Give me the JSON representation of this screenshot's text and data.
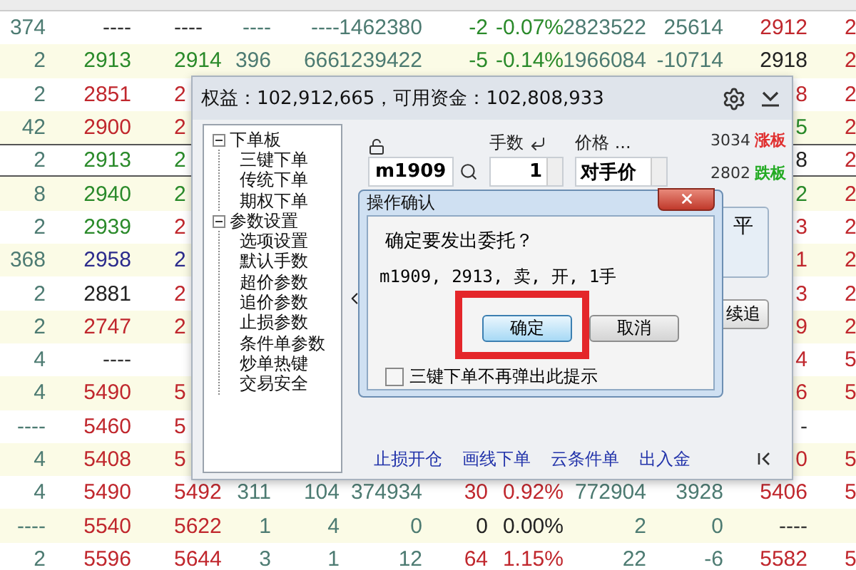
{
  "quote_table": {
    "rows": [
      {
        "selected": false,
        "cells": [
          {
            "text": "374",
            "color": "#4d7b72"
          },
          {
            "text": "----",
            "color": "#333333"
          },
          {
            "text": "----",
            "color": "#333333"
          },
          {
            "text": "----",
            "color": "#4d7b72"
          },
          {
            "text": "----",
            "color": "#4d7b72"
          },
          {
            "text": "1462380",
            "color": "#4d7b72"
          },
          {
            "text": "-2",
            "color": "#2a8a2a"
          },
          {
            "text": "-0.07%",
            "color": "#2a8a2a"
          },
          {
            "text": "2823522",
            "color": "#4d7b72"
          },
          {
            "text": "25614",
            "color": "#4d7b72"
          },
          {
            "text": "2912",
            "color": "#c0272d"
          },
          {
            "text": "2",
            "color": "#c0272d"
          }
        ]
      },
      {
        "selected": false,
        "cells": [
          {
            "text": "2",
            "color": "#4d7b72"
          },
          {
            "text": "2913",
            "color": "#2a8a2a"
          },
          {
            "text": "2914",
            "color": "#2a8a2a"
          },
          {
            "text": "396",
            "color": "#4d7b72"
          },
          {
            "text": "666",
            "color": "#4d7b72"
          },
          {
            "text": "1239422",
            "color": "#4d7b72"
          },
          {
            "text": "-5",
            "color": "#2a8a2a"
          },
          {
            "text": "-0.14%",
            "color": "#2a8a2a"
          },
          {
            "text": "1966084",
            "color": "#4d7b72"
          },
          {
            "text": "-10714",
            "color": "#4d7b72"
          },
          {
            "text": "2918",
            "color": "#222222"
          },
          {
            "text": "2",
            "color": "#c0272d"
          }
        ]
      },
      {
        "selected": false,
        "cells": [
          {
            "text": "2",
            "color": "#4d7b72"
          },
          {
            "text": "2851",
            "color": "#c0272d"
          },
          {
            "text": "2",
            "color": "#c0272d"
          },
          "",
          "",
          "",
          "",
          "",
          "",
          "",
          {
            "text": "8",
            "color": "#c0272d"
          },
          {
            "text": "2",
            "color": "#c0272d"
          }
        ]
      },
      {
        "selected": false,
        "cells": [
          {
            "text": "42",
            "color": "#4d7b72"
          },
          {
            "text": "2900",
            "color": "#c0272d"
          },
          {
            "text": "2",
            "color": "#c0272d"
          },
          "",
          "",
          "",
          "",
          "",
          "",
          "",
          {
            "text": "5",
            "color": "#2a8a2a"
          },
          {
            "text": "2",
            "color": "#c0272d"
          }
        ]
      },
      {
        "selected": true,
        "cells": [
          {
            "text": "2",
            "color": "#4d7b72"
          },
          {
            "text": "2913",
            "color": "#2a8a2a"
          },
          {
            "text": "2",
            "color": "#2a8a2a"
          },
          "",
          "",
          "",
          "",
          "",
          "",
          "",
          {
            "text": "8",
            "color": "#222222"
          },
          {
            "text": "2",
            "color": "#c0272d"
          }
        ]
      },
      {
        "selected": false,
        "cells": [
          {
            "text": "8",
            "color": "#4d7b72"
          },
          {
            "text": "2940",
            "color": "#2a8a2a"
          },
          {
            "text": "2",
            "color": "#2a8a2a"
          },
          "",
          "",
          "",
          "",
          "",
          "",
          "",
          {
            "text": "2",
            "color": "#2a8a2a"
          },
          {
            "text": "2",
            "color": "#c0272d"
          }
        ]
      },
      {
        "selected": false,
        "cells": [
          {
            "text": "2",
            "color": "#4d7b72"
          },
          {
            "text": "2939",
            "color": "#2a8a2a"
          },
          {
            "text": "2",
            "color": "#c0272d"
          },
          "",
          "",
          "",
          "",
          "",
          "",
          "",
          {
            "text": "3",
            "color": "#c0272d"
          },
          {
            "text": "2",
            "color": "#c0272d"
          }
        ]
      },
      {
        "selected": false,
        "cells": [
          {
            "text": "368",
            "color": "#4d7b72"
          },
          {
            "text": "2958",
            "color": "#2b2b8c"
          },
          {
            "text": "2",
            "color": "#2b2b8c"
          },
          "",
          "",
          "",
          "",
          "",
          "",
          "",
          {
            "text": "1",
            "color": "#c0272d"
          },
          {
            "text": "2",
            "color": "#c0272d"
          }
        ]
      },
      {
        "selected": false,
        "cells": [
          {
            "text": "2",
            "color": "#4d7b72"
          },
          {
            "text": "2881",
            "color": "#222222"
          },
          {
            "text": "2",
            "color": "#c0272d"
          },
          "",
          "",
          "",
          "",
          "",
          "",
          "",
          {
            "text": "3",
            "color": "#c0272d"
          },
          {
            "text": "2",
            "color": "#c0272d"
          }
        ]
      },
      {
        "selected": false,
        "cells": [
          {
            "text": "2",
            "color": "#4d7b72"
          },
          {
            "text": "2747",
            "color": "#c0272d"
          },
          {
            "text": "2",
            "color": "#c0272d"
          },
          "",
          "",
          "",
          "",
          "",
          "",
          "",
          {
            "text": "9",
            "color": "#c0272d"
          },
          {
            "text": "2",
            "color": "#c0272d"
          }
        ]
      },
      {
        "selected": false,
        "cells": [
          {
            "text": "4",
            "color": "#4d7b72"
          },
          {
            "text": "----",
            "color": "#333333"
          },
          "",
          "",
          "",
          "",
          "",
          "",
          "",
          "",
          {
            "text": "4",
            "color": "#c0272d"
          },
          {
            "text": "5",
            "color": "#c0272d"
          }
        ]
      },
      {
        "selected": false,
        "cells": [
          {
            "text": "4",
            "color": "#4d7b72"
          },
          {
            "text": "5490",
            "color": "#c0272d"
          },
          {
            "text": "5",
            "color": "#c0272d"
          },
          "",
          "",
          "",
          "",
          "",
          "",
          "",
          {
            "text": "6",
            "color": "#c0272d"
          },
          {
            "text": "5",
            "color": "#c0272d"
          }
        ]
      },
      {
        "selected": false,
        "cells": [
          {
            "text": "----",
            "color": "#4d7b72"
          },
          {
            "text": "5460",
            "color": "#c0272d"
          },
          {
            "text": "5",
            "color": "#c0272d"
          },
          "",
          "",
          "",
          "",
          "",
          "",
          "",
          {
            "text": "-",
            "color": "#333333"
          }
        ]
      },
      {
        "selected": false,
        "cells": [
          {
            "text": "4",
            "color": "#4d7b72"
          },
          {
            "text": "5408",
            "color": "#c0272d"
          },
          {
            "text": "5",
            "color": "#c0272d"
          },
          "",
          "",
          "",
          "",
          "",
          "",
          "",
          {
            "text": "0",
            "color": "#c0272d"
          },
          {
            "text": "5",
            "color": "#c0272d"
          }
        ]
      },
      {
        "selected": false,
        "cells": [
          {
            "text": "4",
            "color": "#4d7b72"
          },
          {
            "text": "5490",
            "color": "#c0272d"
          },
          {
            "text": "5492",
            "color": "#c0272d"
          },
          {
            "text": "311",
            "color": "#4d7b72"
          },
          {
            "text": "104",
            "color": "#4d7b72"
          },
          {
            "text": "374934",
            "color": "#4d7b72"
          },
          {
            "text": "30",
            "color": "#c0272d"
          },
          {
            "text": "0.92%",
            "color": "#c0272d"
          },
          {
            "text": "772904",
            "color": "#4d7b72"
          },
          {
            "text": "3928",
            "color": "#4d7b72"
          },
          {
            "text": "5406",
            "color": "#c0272d"
          },
          {
            "text": "5",
            "color": "#c0272d"
          }
        ]
      },
      {
        "selected": false,
        "cells": [
          {
            "text": "----",
            "color": "#4d7b72"
          },
          {
            "text": "5540",
            "color": "#c0272d"
          },
          {
            "text": "5622",
            "color": "#c0272d"
          },
          {
            "text": "1",
            "color": "#4d7b72"
          },
          {
            "text": "4",
            "color": "#4d7b72"
          },
          {
            "text": "0",
            "color": "#4d7b72"
          },
          {
            "text": "0",
            "color": "#222222"
          },
          {
            "text": "0.00%",
            "color": "#222222"
          },
          {
            "text": "2",
            "color": "#4d7b72"
          },
          {
            "text": "0",
            "color": "#4d7b72"
          },
          {
            "text": "----",
            "color": "#333333"
          }
        ]
      },
      {
        "selected": false,
        "cells": [
          {
            "text": "2",
            "color": "#4d7b72"
          },
          {
            "text": "5596",
            "color": "#c0272d"
          },
          {
            "text": "5644",
            "color": "#c0272d"
          },
          {
            "text": "3",
            "color": "#4d7b72"
          },
          {
            "text": "1",
            "color": "#4d7b72"
          },
          {
            "text": "12",
            "color": "#4d7b72"
          },
          {
            "text": "64",
            "color": "#c0272d"
          },
          {
            "text": "1.15%",
            "color": "#c0272d"
          },
          {
            "text": "22",
            "color": "#4d7b72"
          },
          {
            "text": "-6",
            "color": "#4d7b72"
          },
          {
            "text": "5582",
            "color": "#c0272d"
          },
          {
            "text": "5",
            "color": "#c0272d"
          }
        ]
      }
    ]
  },
  "order_panel": {
    "title": "权益：102,912,665，可用资金：102,808,933",
    "tree": [
      {
        "label": "下单板",
        "expanded": true,
        "children": [
          {
            "label": "三键下单"
          },
          {
            "label": "传统下单"
          },
          {
            "label": "期权下单"
          }
        ]
      },
      {
        "label": "参数设置",
        "expanded": true,
        "children": [
          {
            "label": "选项设置"
          },
          {
            "label": "默认手数"
          },
          {
            "label": "超价参数"
          },
          {
            "label": "追价参数"
          },
          {
            "label": "止损参数"
          },
          {
            "label": "条件单参数"
          },
          {
            "label": "炒单热键"
          },
          {
            "label": "交易安全"
          }
        ]
      }
    ],
    "symbol": {
      "value": "m1909"
    },
    "qty_label": "手数",
    "qty": {
      "value": "1"
    },
    "price_label": "价格 ...",
    "price": {
      "value": "对手价"
    },
    "limits": [
      {
        "price": "3034",
        "label": "涨板",
        "color": "#e03030"
      },
      {
        "price": "2802",
        "label": "跌板",
        "color": "#22aa22"
      }
    ],
    "side_buttons": [
      {
        "kind": "panel",
        "label": "平"
      },
      {
        "kind": "button",
        "label": "续追"
      }
    ],
    "links": [
      "止损开仓",
      "画线下单",
      "云条件单",
      "出入金"
    ]
  },
  "confirm_dialog": {
    "title": "操作确认",
    "message": "确定要发出委托？",
    "detail": "m1909, 2913, 卖, 开, 1手",
    "buttons": [
      {
        "label": "确定",
        "selected": true
      },
      {
        "label": "取消",
        "selected": false
      }
    ],
    "highlight": true,
    "checkbox": {
      "label": "三键下单不再弹出此提示",
      "checked": false
    }
  }
}
